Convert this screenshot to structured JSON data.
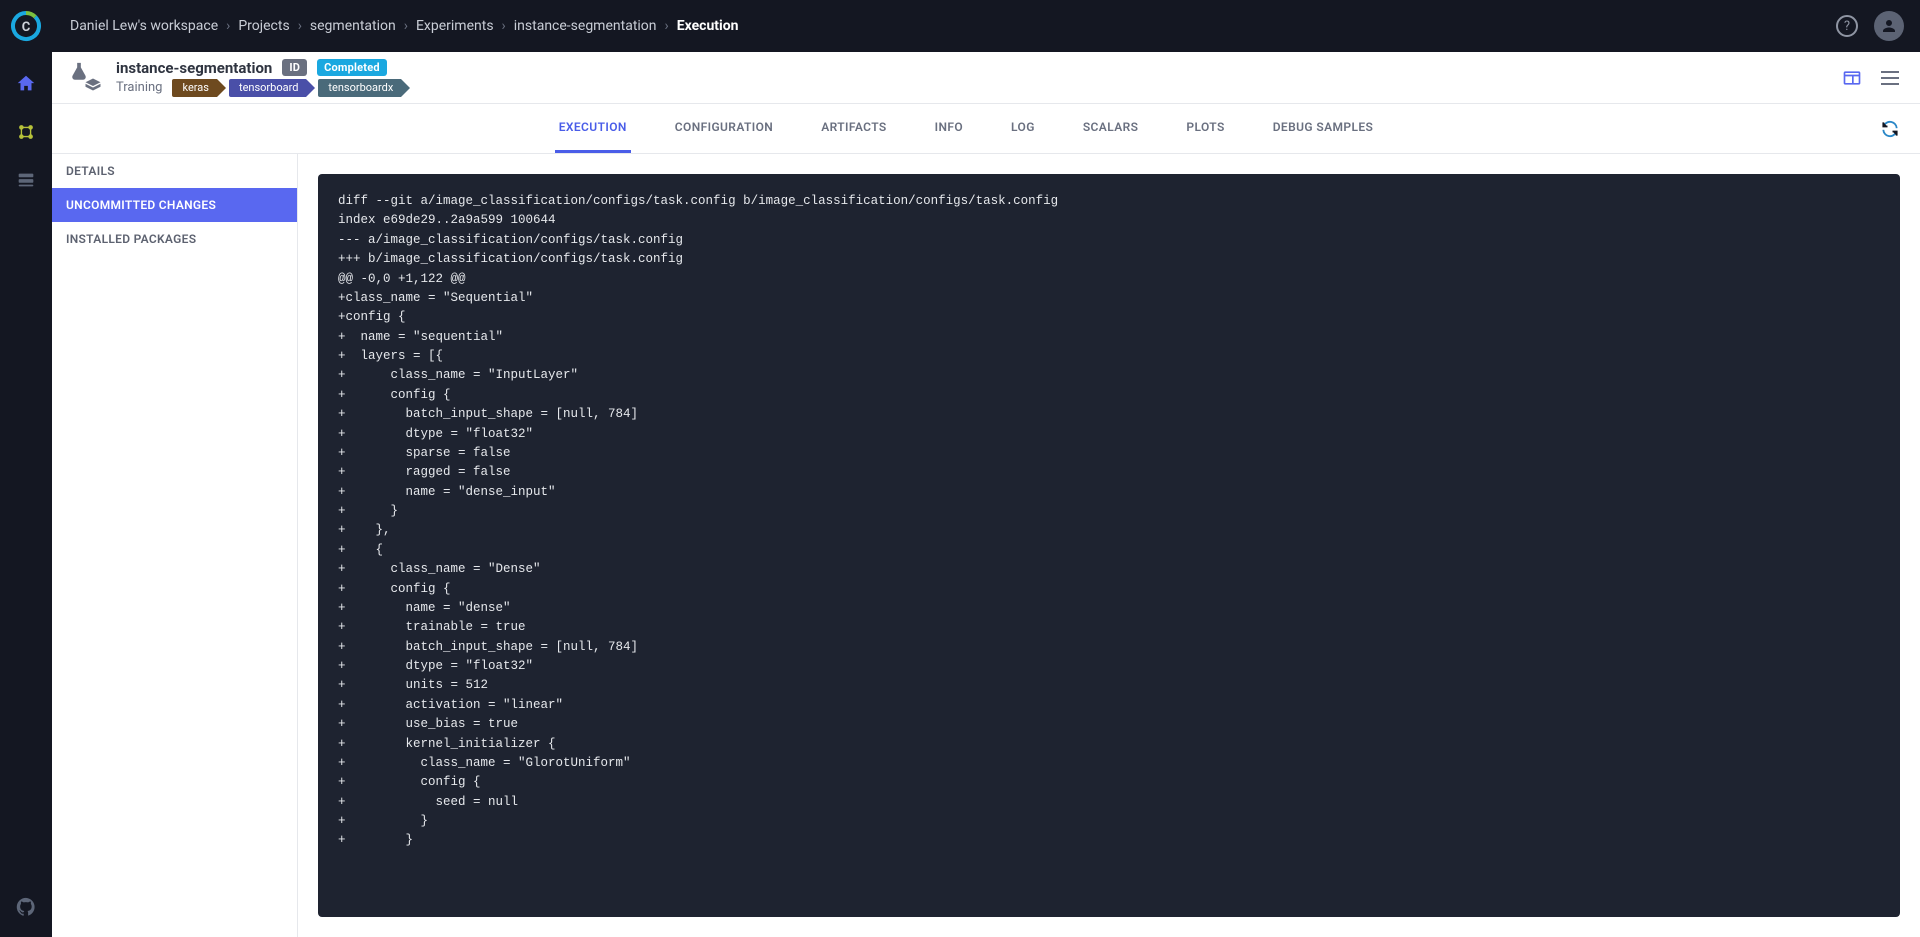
{
  "breadcrumbs": {
    "workspace": "Daniel Lew's workspace",
    "projects": "Projects",
    "project": "segmentation",
    "experiments": "Experiments",
    "experiment": "instance-segmentation",
    "current": "Execution"
  },
  "header": {
    "title": "instance-segmentation",
    "id_badge": "ID",
    "status_badge": "Completed",
    "task_type": "Training",
    "tags": {
      "keras": "keras",
      "tensorboard": "tensorboard",
      "tensorboardx": "tensorboardx"
    }
  },
  "tabs": {
    "execution": "EXECUTION",
    "configuration": "CONFIGURATION",
    "artifacts": "ARTIFACTS",
    "info": "INFO",
    "log": "LOG",
    "scalars": "SCALARS",
    "plots": "PLOTS",
    "debug_samples": "DEBUG SAMPLES"
  },
  "sidepanel": {
    "details": "DETAILS",
    "uncommitted": "UNCOMMITTED CHANGES",
    "installed": "INSTALLED PACKAGES"
  },
  "diff": "diff --git a/image_classification/configs/task.config b/image_classification/configs/task.config\nindex e69de29..2a9a599 100644\n--- a/image_classification/configs/task.config\n+++ b/image_classification/configs/task.config\n@@ -0,0 +1,122 @@\n+class_name = \"Sequential\"\n+config {\n+  name = \"sequential\"\n+  layers = [{\n+      class_name = \"InputLayer\"\n+      config {\n+        batch_input_shape = [null, 784]\n+        dtype = \"float32\"\n+        sparse = false\n+        ragged = false\n+        name = \"dense_input\"\n+      }\n+    },\n+    {\n+      class_name = \"Dense\"\n+      config {\n+        name = \"dense\"\n+        trainable = true\n+        batch_input_shape = [null, 784]\n+        dtype = \"float32\"\n+        units = 512\n+        activation = \"linear\"\n+        use_bias = true\n+        kernel_initializer {\n+          class_name = \"GlorotUniform\"\n+          config {\n+            seed = null\n+          }\n+        }"
}
